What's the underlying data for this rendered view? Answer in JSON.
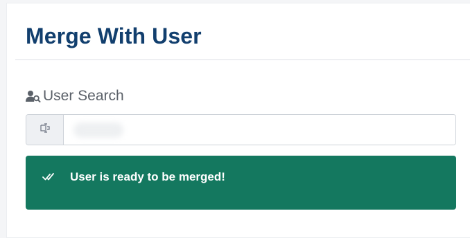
{
  "page": {
    "title": "Merge With User"
  },
  "search": {
    "label": "User Search",
    "label_icon": "user-search-icon",
    "addon_icon": "text-cursor-icon",
    "value": "",
    "placeholder": ""
  },
  "alert": {
    "icon": "double-check-icon",
    "message": "User is ready to be merged!",
    "color": "#14785f"
  },
  "colors": {
    "title": "#123f6e",
    "label": "#5b6169",
    "alert_bg": "#14785f"
  }
}
